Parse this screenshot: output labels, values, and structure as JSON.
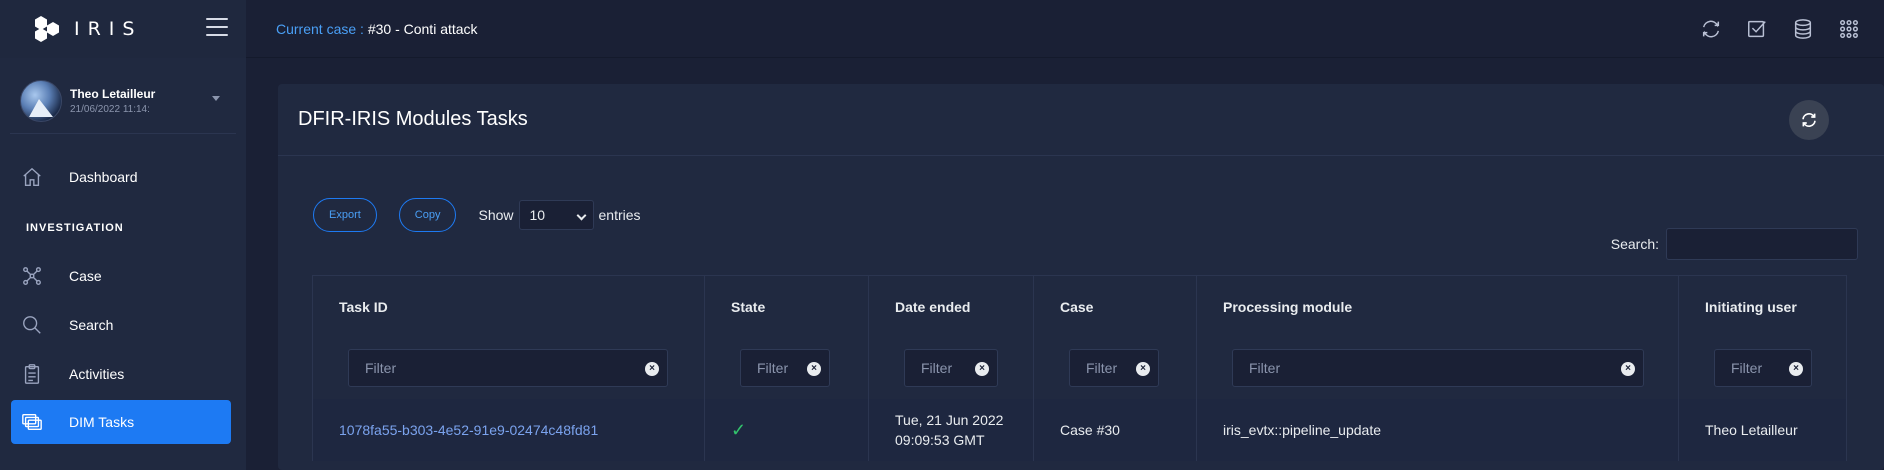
{
  "app": {
    "logo_text": "IRIS"
  },
  "user": {
    "name": "Theo Letailleur",
    "date": "21/06/2022 11:14:"
  },
  "sidebar": {
    "items": [
      {
        "label": "Dashboard",
        "icon": "home-icon"
      },
      {
        "label": "Case",
        "icon": "share-nodes-icon"
      },
      {
        "label": "Search",
        "icon": "search-icon"
      },
      {
        "label": "Activities",
        "icon": "clipboard-list-icon"
      },
      {
        "label": "DIM Tasks",
        "icon": "layers-icon"
      }
    ],
    "section_investigation": "INVESTIGATION",
    "active_item": "DIM Tasks"
  },
  "header": {
    "case_label": "Current case : ",
    "case_value": "#30 - Conti attack",
    "icons": [
      "sync-icon",
      "checkbox-icon",
      "database-icon",
      "grid-icon"
    ]
  },
  "card": {
    "title": "DFIR-IRIS Modules Tasks",
    "export_label": "Export",
    "copy_label": "Copy",
    "show_label": "Show",
    "entries_value": "10",
    "entries_label": "entries",
    "search_label": "Search:"
  },
  "table": {
    "columns": [
      "Task ID",
      "State",
      "Date ended",
      "Case",
      "Processing module",
      "Initiating user"
    ],
    "filter_placeholder": "Filter",
    "rows": [
      {
        "task_id": "1078fa55-b303-4e52-91e9-02474c48fd81",
        "state": "✓",
        "date_line1": "Tue, 21 Jun 2022",
        "date_line2": "09:09:53 GMT",
        "case": "Case #30",
        "module": "iris_evtx::pipeline_update",
        "user": "Theo Letailleur"
      }
    ]
  },
  "colors": {
    "accent": "#1d7af3",
    "background": "#1a2035",
    "panel": "#202940",
    "success": "#32c36c"
  }
}
